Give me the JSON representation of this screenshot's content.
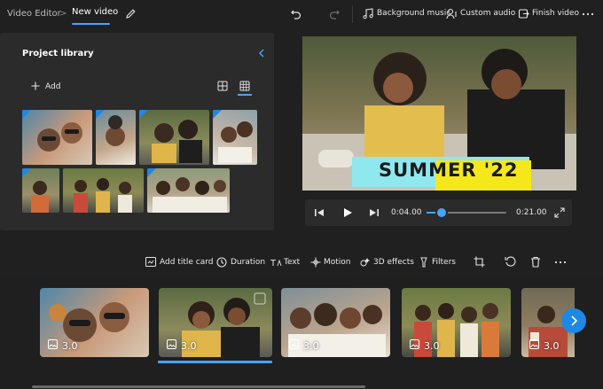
{
  "app": {
    "breadcrumb_root": "Video Editor",
    "breadcrumb_separator": ">",
    "project_name": "New video"
  },
  "top_actions": {
    "background_music": "Background music",
    "custom_audio": "Custom audio",
    "finish_video": "Finish video"
  },
  "library": {
    "title": "Project library",
    "add_label": "Add"
  },
  "preview": {
    "title_card_text": "SUMMER '22",
    "current_time": "0:04.00",
    "total_time": "0:21.00",
    "progress_fraction": 0.19
  },
  "storyboard_toolbar": {
    "add_title_card": "Add title card",
    "duration": "Duration",
    "text": "Text",
    "motion": "Motion",
    "effects_3d": "3D effects",
    "filters": "Filters"
  },
  "storyboard": {
    "clips": [
      {
        "duration": "3.0"
      },
      {
        "duration": "3.0"
      },
      {
        "duration": "3.0"
      },
      {
        "duration": "3.0"
      },
      {
        "duration": "3.0"
      }
    ],
    "selected_index": 1
  },
  "colors": {
    "accent": "#4aa3ff",
    "panel": "#2b2b2b",
    "background": "#202020",
    "title_cyan": "#8ee8ee",
    "title_yellow": "#f5e81a"
  }
}
